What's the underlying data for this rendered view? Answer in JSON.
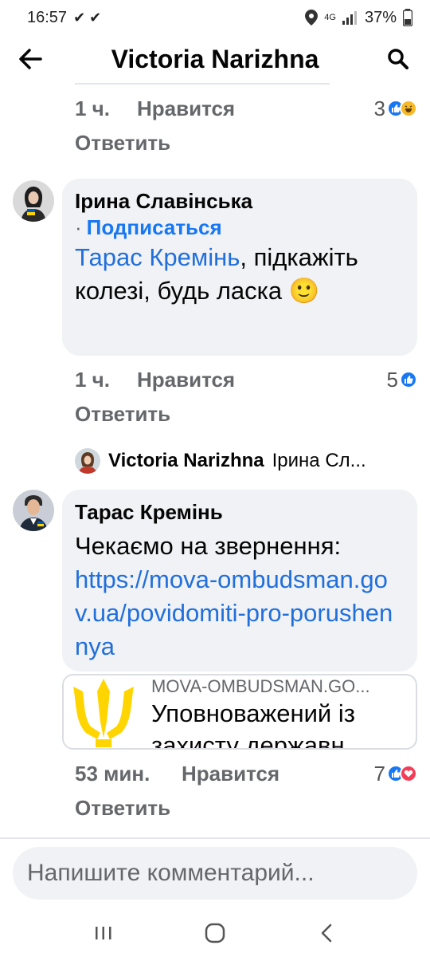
{
  "status": {
    "time": "16:57",
    "checks": "✔ ✔",
    "network": "4G",
    "battery": "37%"
  },
  "header": {
    "title": "Victoria Narizhna"
  },
  "thread": {
    "top_meta": {
      "time": "1 ч.",
      "like_label": "Нравится",
      "count": "3",
      "reply_label": "Ответить"
    },
    "comment1": {
      "author": "Ірина Славінська",
      "follow_label": "Подписаться",
      "mention": "Тарас Кремінь",
      "text": ", підкажіть колезі, будь ласка",
      "emoji": "🙂",
      "meta": {
        "time": "1 ч.",
        "like_label": "Нравится",
        "count": "5",
        "reply_label": "Ответить"
      }
    },
    "reply_preview": {
      "author": "Victoria Narizhna",
      "snippet": "Ірина Сл..."
    },
    "comment2": {
      "author": "Тарас Кремінь",
      "text": "Чекаємо на звернення:",
      "link": "https://mova-ombudsman.gov.ua/povidomiti-pro-porushennya",
      "card": {
        "domain": "MOVA-OMBUDSMAN.GO...",
        "title": "Уповноважений із захисту державн"
      },
      "meta": {
        "time": "53 мин.",
        "like_label": "Нравится",
        "count": "7",
        "reply_label": "Ответить"
      }
    }
  },
  "composer": {
    "placeholder": "Напишите комментарий..."
  },
  "colors": {
    "accent": "#1877f2",
    "bubble": "#f0f2f5",
    "meta": "#65676b",
    "trident": "#ffd500"
  }
}
